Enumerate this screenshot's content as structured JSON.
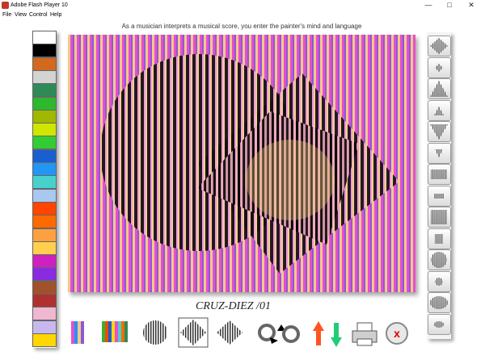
{
  "window": {
    "title": "Adobe Flash Player 10",
    "minimize": "—",
    "maximize": "□",
    "close": "✕"
  },
  "menu": [
    "File",
    "View",
    "Control",
    "Help"
  ],
  "caption": "As a musician interprets a musical score, you enter the painter's mind and language",
  "signature_text": "CRUZ-DIEZ /01",
  "palette_colors": [
    "#ffffff",
    "#000000",
    "#d2691e",
    "#d3d3d3",
    "#2e8b57",
    "#2eb82e",
    "#a0b800",
    "#cfe600",
    "#32cd32",
    "#1a5fd0",
    "#2196f3",
    "#48d1cc",
    "#a8c8f0",
    "#ff4500",
    "#ff6a00",
    "#ffa040",
    "#ffd050",
    "#d020c0",
    "#8a2be2",
    "#a0522d",
    "#b03030",
    "#f0b8d0",
    "#c8b8f0",
    "#ffd700"
  ],
  "artwork": {
    "stripe_colors": [
      "#f5c88a",
      "#e54fd0",
      "#8a5ad6"
    ],
    "inner_stripe_colors": [
      "#000000",
      "#ffb0e0"
    ]
  },
  "shape_icons": [
    "diamond-large-icon",
    "diamond-small-icon",
    "triangle-up-large-icon",
    "triangle-up-small-icon",
    "triangle-down-large-icon",
    "triangle-down-small-icon",
    "stripes-large-icon",
    "stripes-small-icon",
    "stripes-square-icon",
    "stripes-square-small-icon",
    "circle-large-icon",
    "circle-small-icon",
    "ellipse-large-icon",
    "ellipse-small-icon"
  ],
  "toolbar_icons": [
    "color-bars-icon",
    "multicolor-bars-icon",
    "circle-pattern-icon",
    "diamond-pattern-icon",
    "diamond-pattern-alt-icon",
    "rotate-icon",
    "move-up-down-icon",
    "print-icon",
    "clear-icon"
  ]
}
